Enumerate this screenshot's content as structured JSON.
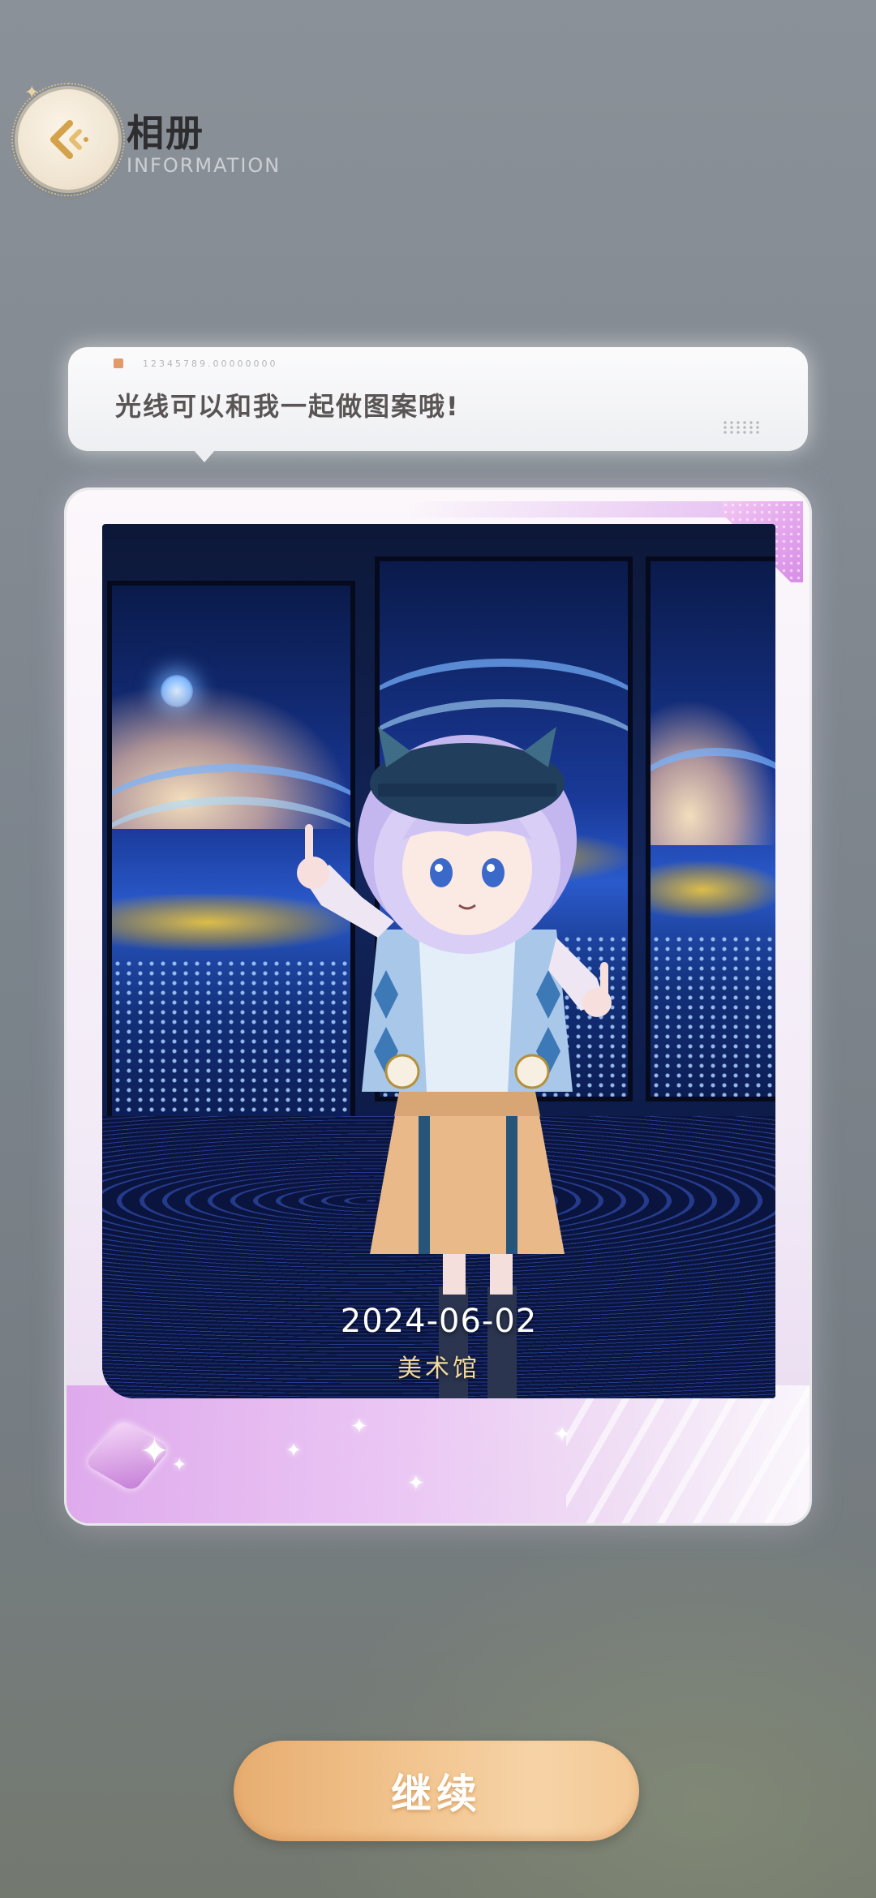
{
  "header": {
    "title": "相册",
    "subtitle": "INFORMATION",
    "back_icon": "chevron-left-icon"
  },
  "bubble": {
    "meta": "12345789.00000000",
    "message": "光线可以和我一起做图案哦!"
  },
  "photo": {
    "date": "2024-06-02",
    "location": "美术馆"
  },
  "footer": {
    "continue_label": "继续"
  },
  "colors": {
    "accent_orange": "#f2c590",
    "card_purple": "#d78ce6",
    "title_dark": "#2e2e30"
  }
}
